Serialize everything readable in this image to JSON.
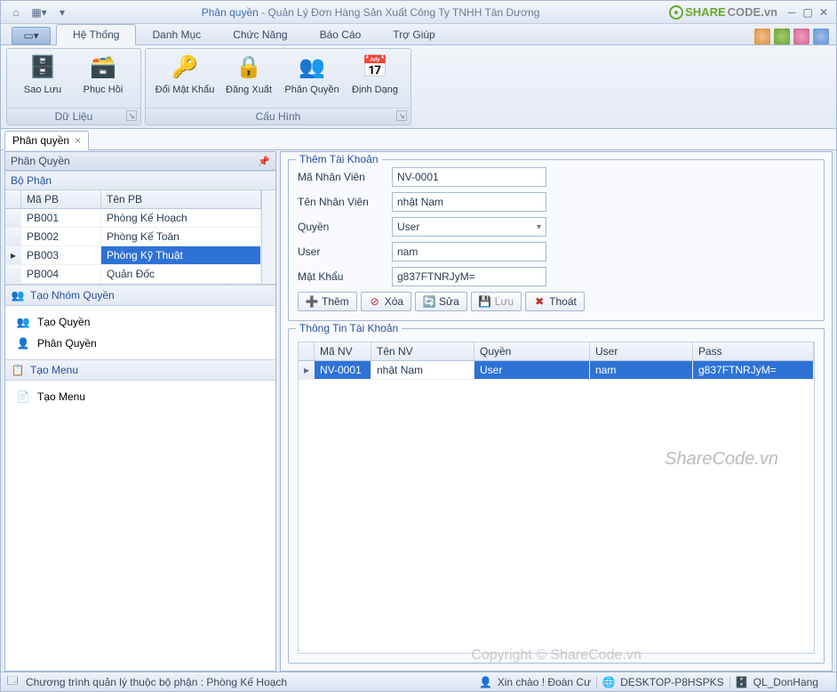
{
  "title": {
    "a": "Phân quyền",
    "sep": " - ",
    "b": "Quản Lý Đơn Hàng Sản Xuất Công Ty TNHH Tân Dương"
  },
  "share": {
    "s1": "SHARE",
    "s2": "CODE.vn"
  },
  "ribbon": {
    "tabs": [
      "Hệ Thống",
      "Danh Mục",
      "Chức Năng",
      "Báo Cáo",
      "Trợ Giúp"
    ],
    "active": 0,
    "groups": [
      {
        "title": "Dữ Liệu",
        "items": [
          {
            "label": "Sao Lưu",
            "icon": "🗄️",
            "name": "backup"
          },
          {
            "label": "Phục Hồi",
            "icon": "🗃️",
            "name": "restore"
          }
        ]
      },
      {
        "title": "Cấu Hình",
        "items": [
          {
            "label": "Đổi Mật Khẩu",
            "icon": "🔑",
            "name": "change-password"
          },
          {
            "label": "Đăng Xuất",
            "icon": "🔒",
            "name": "logout"
          },
          {
            "label": "Phân Quyền",
            "icon": "👥",
            "name": "permissions"
          },
          {
            "label": "Định Dạng",
            "icon": "📅",
            "name": "format"
          }
        ]
      }
    ]
  },
  "doctab": {
    "label": "Phân quyền"
  },
  "left": {
    "paneltitle": "Phân Quyền",
    "deptgroup": "Bộ Phận",
    "gridhdr": {
      "c1": "Mã PB",
      "c2": "Tên PB"
    },
    "rows": [
      {
        "c1": "PB001",
        "c2": "Phòng Kế Hoạch",
        "sel": false
      },
      {
        "c1": "PB002",
        "c2": "Phòng Kế Toán",
        "sel": false
      },
      {
        "c1": "PB003",
        "c2": "Phòng Kỹ Thuật",
        "sel": true
      },
      {
        "c1": "PB004",
        "c2": "Quản Đốc",
        "sel": false
      }
    ],
    "group2": "Tạo Nhóm Quyền",
    "group2items": [
      "Tạo Quyền",
      "Phân Quyền"
    ],
    "group3": "Tạo Menu",
    "group3items": [
      "Tạo Menu"
    ]
  },
  "form": {
    "legend": "Thêm Tài Khoản",
    "f1l": "Mã Nhân Viên",
    "f1v": "NV-0001",
    "f2l": "Tên Nhân Viên",
    "f2v": "nhật Nam",
    "f3l": "Quyền",
    "f3v": "User",
    "f4l": "User",
    "f4v": "nam",
    "f5l": "Mật Khẩu",
    "f5v": "g837FTNRJyM=",
    "btns": {
      "add": "Thêm",
      "del": "Xóa",
      "edit": "Sửa",
      "save": "Lưu",
      "exit": "Thoát"
    }
  },
  "accounts": {
    "legend": "Thông Tin Tài Khoản",
    "hdr": [
      "Mã NV",
      "Tên NV",
      "Quyền",
      "User",
      "Pass"
    ],
    "rows": [
      {
        "c": [
          "NV-0001",
          "nhật Nam",
          "User",
          "nam",
          "g837FTNRJyM="
        ],
        "sel": true
      }
    ]
  },
  "watermark": "ShareCode.vn",
  "copyright": "Copyright © ShareCode.vn",
  "status": {
    "left": "Chương trình quản lý thuộc bộ phận : Phòng Kế Hoạch",
    "user": "Xin chào ! Đoàn Cư",
    "host": "DESKTOP-P8HSPKS",
    "db": "QL_DonHang"
  }
}
